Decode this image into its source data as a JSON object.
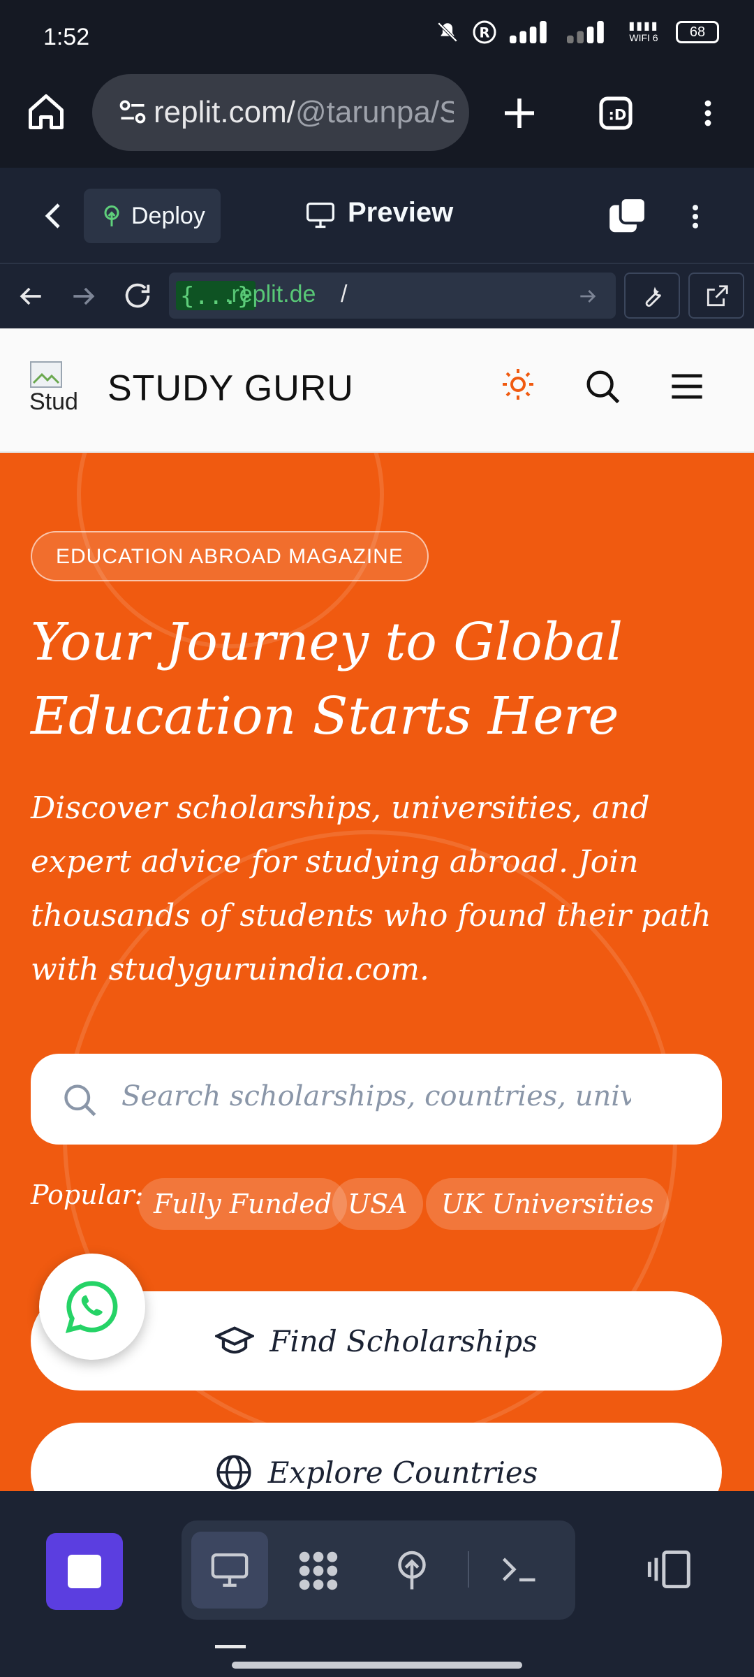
{
  "status_bar": {
    "time": "1:52",
    "battery": "68",
    "wifi_label": "WIFI 6"
  },
  "browser": {
    "url_host": "replit.com/",
    "url_rest": "@tarunpa/S"
  },
  "replit_toolbar": {
    "deploy_label": "Deploy",
    "preview_label": "Preview"
  },
  "address_bar": {
    "badge": "{...}",
    "host": ".replit.de",
    "path": "/"
  },
  "site": {
    "logo_alt": "Stud",
    "brand": "STUDY GURU",
    "accent": "#f05a10",
    "badge": "EDUCATION ABROAD MAGAZINE",
    "headline": "Your Journey to Global Education Starts Here",
    "subtext": "Discover scholarships, universities, and expert advice for studying abroad. Join thousands of students who found their path with studyguruindia.com.",
    "search_placeholder": "Search scholarships, countries, universities...",
    "popular_label": "Popular:",
    "chips": [
      "Fully Funded",
      "USA",
      "UK Universities"
    ],
    "cta_primary": "Find Scholarships",
    "cta_secondary": "Explore Countries"
  },
  "icons": {
    "home": "home-icon",
    "tune": "site-settings-icon",
    "plus": "new-tab-icon",
    "tabs": "tab-switcher-icon",
    "more": "more-vertical-icon",
    "back": "chevron-left-icon",
    "sun": "sun-icon",
    "search": "search-icon",
    "menu": "hamburger-icon"
  }
}
